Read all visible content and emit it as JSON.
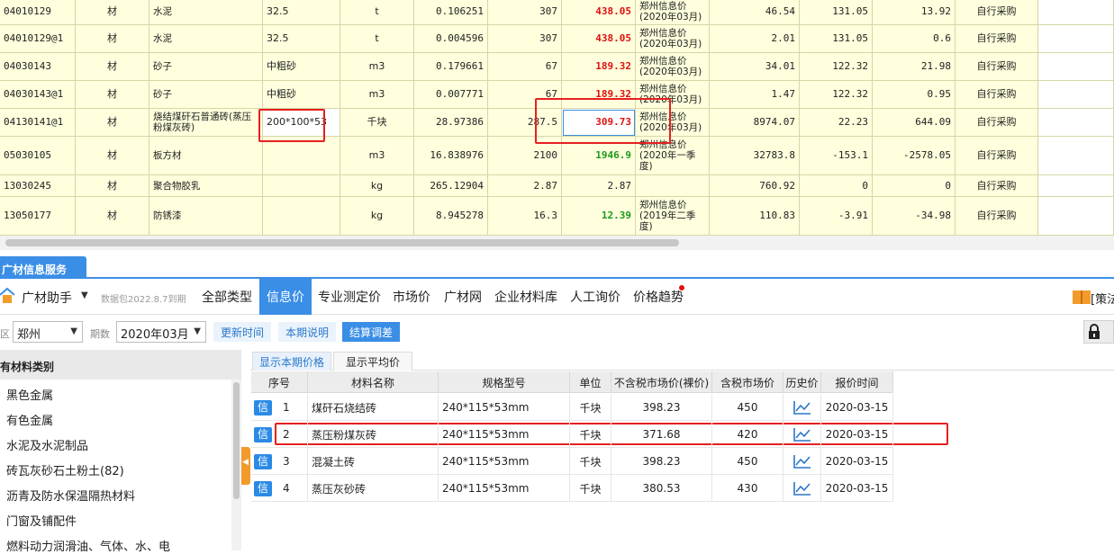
{
  "top_grid": {
    "rows": [
      {
        "code": "04010129",
        "type": "材",
        "name": "水泥",
        "spec": "32.5",
        "unit": "t",
        "qty": "0.106251",
        "base_price": "307",
        "market_price": "438.05",
        "price_color": "red",
        "source": "郑州信息价(2020年03月)",
        "amount": "46.54",
        "diff": "131.05",
        "diff_total": "13.92",
        "supply": "自行采购"
      },
      {
        "code": "04010129@1",
        "type": "材",
        "name": "水泥",
        "spec": "32.5",
        "unit": "t",
        "qty": "0.004596",
        "base_price": "307",
        "market_price": "438.05",
        "price_color": "red",
        "source": "郑州信息价(2020年03月)",
        "amount": "2.01",
        "diff": "131.05",
        "diff_total": "0.6",
        "supply": "自行采购"
      },
      {
        "code": "04030143",
        "type": "材",
        "name": "砂子",
        "spec": "中粗砂",
        "unit": "m3",
        "qty": "0.179661",
        "base_price": "67",
        "market_price": "189.32",
        "price_color": "red",
        "source": "郑州信息价(2020年03月)",
        "amount": "34.01",
        "diff": "122.32",
        "diff_total": "21.98",
        "supply": "自行采购"
      },
      {
        "code": "04030143@1",
        "type": "材",
        "name": "砂子",
        "spec": "中粗砂",
        "unit": "m3",
        "qty": "0.007771",
        "base_price": "67",
        "market_price": "189.32",
        "price_color": "red",
        "source": "郑州信息价(2020年03月)",
        "amount": "1.47",
        "diff": "122.32",
        "diff_total": "0.95",
        "supply": "自行采购"
      },
      {
        "code": "04130141@1",
        "type": "材",
        "name": "烧结煤矸石普通砖(蒸压粉煤灰砖)",
        "spec": "200*100*53",
        "unit": "千块",
        "qty": "28.97386",
        "base_price": "287.5",
        "market_price": "309.73",
        "price_color": "red",
        "source": "郑州信息价(2020年03月)",
        "amount": "8974.07",
        "diff": "22.23",
        "diff_total": "644.09",
        "supply": "自行采购"
      },
      {
        "code": "05030105",
        "type": "材",
        "name": "板方材",
        "spec": "",
        "unit": "m3",
        "qty": "16.838976",
        "base_price": "2100",
        "market_price": "1946.9",
        "price_color": "green",
        "source": "郑州信息价(2020年一季度)",
        "amount": "32783.8",
        "diff": "-153.1",
        "diff_total": "-2578.05",
        "supply": "自行采购"
      },
      {
        "code": "13030245",
        "type": "材",
        "name": "聚合物胶乳",
        "spec": "",
        "unit": "kg",
        "qty": "265.12904",
        "base_price": "2.87",
        "market_price": "2.87",
        "price_color": "normal",
        "source": "",
        "amount": "760.92",
        "diff": "0",
        "diff_total": "0",
        "supply": "自行采购"
      },
      {
        "code": "13050177",
        "type": "材",
        "name": "防锈漆",
        "spec": "",
        "unit": "kg",
        "qty": "8.945278",
        "base_price": "16.3",
        "market_price": "12.39",
        "price_color": "green",
        "source": "郑州信息价(2019年二季度)",
        "amount": "110.83",
        "diff": "-3.91",
        "diff_total": "-34.98",
        "supply": "自行采购"
      }
    ]
  },
  "panel": {
    "title": "广材信息服务",
    "helper_label": "广材助手",
    "package_info": "数据包2022.8.7到期",
    "tabs": [
      "全部类型",
      "信息价",
      "专业测定价",
      "市场价",
      "广材网",
      "企业材料库",
      "人工询价",
      "价格趋势"
    ],
    "active_tab": "信息价",
    "policy_label": "[策法",
    "home_icon": "home-icon",
    "book_icon": "book-icon"
  },
  "filters": {
    "region_label": "区",
    "region_value": "郑州",
    "period_label": "期数",
    "period_value": "2020年03月",
    "btn_update": "更新时间",
    "btn_explain": "本期说明",
    "btn_settle": "结算调差",
    "lock_icon": "lock-icon"
  },
  "left_panel": {
    "header": "有材料类别",
    "items": [
      "黑色金属",
      "有色金属",
      "水泥及水泥制品",
      "砖瓦灰砂石土粉土(82)",
      "沥青及防水保温隔热材料",
      "门窗及铺配件",
      "燃料动力润滑油、气体、水、电"
    ]
  },
  "right_panel": {
    "subtabs": [
      "显示本期价格",
      "显示平均价"
    ],
    "columns": [
      "序号",
      "材料名称",
      "规格型号",
      "单位",
      "不含税市场价(裸价)",
      "含税市场价",
      "历史价",
      "报价时间"
    ],
    "tag": "信",
    "rows": [
      {
        "seq": "1",
        "name": "煤矸石烧结砖",
        "spec": "240*115*53mm",
        "unit": "千块",
        "price_ex_tax": "398.23",
        "price_inc_tax": "450",
        "date": "2020-03-15"
      },
      {
        "seq": "2",
        "name": "蒸压粉煤灰砖",
        "spec": "240*115*53mm",
        "unit": "千块",
        "price_ex_tax": "371.68",
        "price_inc_tax": "420",
        "date": "2020-03-15"
      },
      {
        "seq": "3",
        "name": "混凝土砖",
        "spec": "240*115*53mm",
        "unit": "千块",
        "price_ex_tax": "398.23",
        "price_inc_tax": "450",
        "date": "2020-03-15"
      },
      {
        "seq": "4",
        "name": "蒸压灰砂砖",
        "spec": "240*115*53mm",
        "unit": "千块",
        "price_ex_tax": "380.53",
        "price_inc_tax": "430",
        "date": "2020-03-15"
      }
    ],
    "history_icon": "trend-chart-icon"
  },
  "colors": {
    "accent": "#3a8ee6",
    "row_yellow": "#ffffdd",
    "price_up": "#e01010",
    "price_down": "#1a9a1a",
    "annotation": "#e52020",
    "collapse_handle": "#f29b2b"
  }
}
